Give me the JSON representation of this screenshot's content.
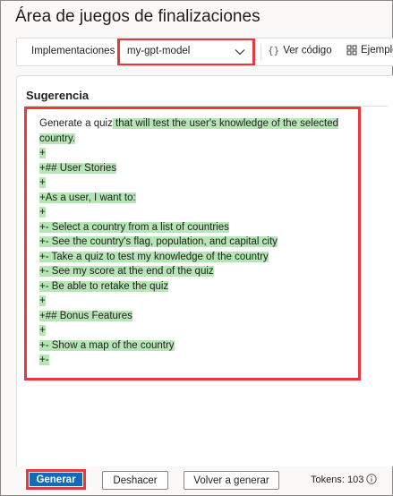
{
  "page": {
    "title": "Área de juegos de finalizaciones"
  },
  "toolbar": {
    "deployments_label": "Implementaciones",
    "deployment_value": "my-gpt-model",
    "view_code_label": "Ver código",
    "examples_label": "Ejemplos"
  },
  "panel": {
    "title": "Sugerencia",
    "lines": [
      {
        "plain": "Generate a quiz",
        "highlight": " that will test the user's knowledge of the selected"
      },
      {
        "plain": "",
        "highlight": "country."
      },
      {
        "plain": "",
        "highlight": "+"
      },
      {
        "plain": "",
        "highlight": "+## User Stories"
      },
      {
        "plain": "",
        "highlight": "+"
      },
      {
        "plain": "",
        "highlight": "+As a user, I want to:"
      },
      {
        "plain": "",
        "highlight": "+"
      },
      {
        "plain": "",
        "highlight": "+- Select a country from a list of countries"
      },
      {
        "plain": "",
        "highlight": "+- See the country's flag, population, and capital city"
      },
      {
        "plain": "",
        "highlight": "+- Take a quiz to test my knowledge of the country"
      },
      {
        "plain": "",
        "highlight": "+- See my score at the end of the quiz"
      },
      {
        "plain": "",
        "highlight": "+- Be able to retake the quiz"
      },
      {
        "plain": "",
        "highlight": "+"
      },
      {
        "plain": "",
        "highlight": "+## Bonus Features"
      },
      {
        "plain": "",
        "highlight": "+"
      },
      {
        "plain": "",
        "highlight": "+- Show a map of the country"
      },
      {
        "plain": "",
        "highlight": "+-"
      }
    ]
  },
  "actions": {
    "generate_label": "Generar",
    "undo_label": "Deshacer",
    "regenerate_label": "Volver a generar",
    "tokens_label": "Tokens: 103"
  },
  "colors": {
    "accent": "#0f6cbd",
    "highlight": "#b6e6b6",
    "callout": "#e8383d"
  },
  "icons": [
    "chevron-down-icon",
    "code-braces-icon",
    "examples-grid-icon",
    "info-icon"
  ]
}
